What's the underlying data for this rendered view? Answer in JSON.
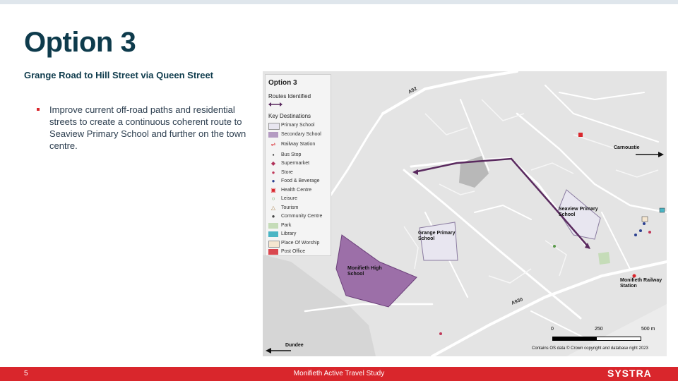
{
  "slide": {
    "title": "Option 3",
    "subtitle": "Grange Road to Hill Street via Queen Street",
    "bullets": [
      "Improve current off-road paths and residential streets to create a continuous coherent route to Seaview Primary School and further on the town centre."
    ]
  },
  "map": {
    "legend": {
      "title": "Option 3",
      "routes_heading": "Routes Identified",
      "destinations_heading": "Key Destinations",
      "items": [
        {
          "label": "Primary School",
          "icon": "primary-school-swatch",
          "color": "#e8e6f0"
        },
        {
          "label": "Secondary School",
          "icon": "secondary-school-swatch",
          "color": "#b49bc2"
        },
        {
          "label": "Railway Station",
          "icon": "railway-station-icon",
          "color": "#d9262c"
        },
        {
          "label": "Bus Stop",
          "icon": "bus-stop-icon",
          "color": "#333333"
        },
        {
          "label": "Supermarket",
          "icon": "supermarket-icon",
          "color": "#b0325a"
        },
        {
          "label": "Store",
          "icon": "store-icon",
          "color": "#c0395a"
        },
        {
          "label": "Food & Beverage",
          "icon": "food-beverage-icon",
          "color": "#2a3f8f"
        },
        {
          "label": "Health Centre",
          "icon": "health-centre-icon",
          "color": "#d9262c"
        },
        {
          "label": "Leisure",
          "icon": "leisure-icon",
          "color": "#5a9a4a"
        },
        {
          "label": "Tourism",
          "icon": "tourism-icon",
          "color": "#b08a5a"
        },
        {
          "label": "Community Centre",
          "icon": "community-centre-icon",
          "color": "#444444"
        },
        {
          "label": "Park",
          "icon": "park-swatch",
          "color": "#c5dcb8"
        },
        {
          "label": "Library",
          "icon": "library-swatch",
          "color": "#4ab5c4"
        },
        {
          "label": "Place Of Worship",
          "icon": "place-of-worship-swatch",
          "color": "#f5e6d0"
        },
        {
          "label": "Post Office",
          "icon": "post-office-swatch",
          "color": "#d9474f"
        }
      ]
    },
    "route_color": "#5a2a5f",
    "labels": {
      "seaview": "Seaview Primary School",
      "grange": "Grange Primary School",
      "monifieth_high": "Monifieth High School",
      "station": "Monifieth Railway Station",
      "carnoustie": "Carnoustie",
      "dundee": "Dundee",
      "a92": "A92",
      "a930": "A930"
    },
    "scale": {
      "zero": "0",
      "mid": "250",
      "end": "500 m"
    },
    "credit": "Contains OS data © Crown copyright and database right 2023"
  },
  "footer": {
    "page_number": "5",
    "study_name": "Monifieth Active Travel Study",
    "logo_text": "SYSTRA"
  }
}
